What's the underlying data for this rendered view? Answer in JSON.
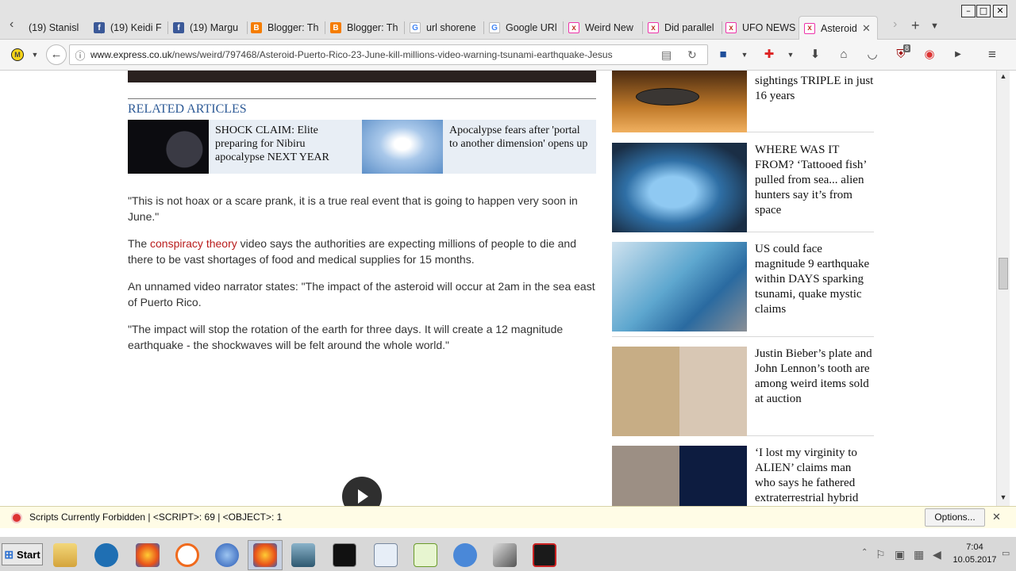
{
  "browser": {
    "tabs": [
      {
        "label": "(19) Stanisl",
        "icon": "facebook-icon"
      },
      {
        "label": "(19) Keidi F",
        "icon": "facebook-icon"
      },
      {
        "label": "(19) Margu",
        "icon": "facebook-icon"
      },
      {
        "label": "Blogger: Th",
        "icon": "blogger-icon"
      },
      {
        "label": "Blogger: Th",
        "icon": "blogger-icon"
      },
      {
        "label": "url shorene",
        "icon": "google-icon"
      },
      {
        "label": "Google URl",
        "icon": "google-icon"
      },
      {
        "label": "Weird New",
        "icon": "express-icon"
      },
      {
        "label": "Did parallel",
        "icon": "express-icon"
      },
      {
        "label": "UFO NEWS",
        "icon": "express-icon"
      },
      {
        "label": "Asteroid",
        "icon": "express-icon",
        "active": true
      }
    ],
    "url_host": "www.express.co.uk",
    "url_path": "/news/weird/797468/Asteroid-Puerto-Rico-23-June-kill-millions-video-warning-tsunami-earthquake-Jesus",
    "ublock_badge": "8"
  },
  "article": {
    "related_heading": "RELATED ARTICLES",
    "related": [
      {
        "title": "SHOCK CLAIM: Elite preparing for Nibiru apocalypse NEXT YEAR"
      },
      {
        "title": "Apocalypse fears after 'portal to another dimension' opens up"
      }
    ],
    "paragraphs": {
      "p1": "\"This is not hoax or a scare prank, it is a true real event that is going to happen very soon in June.\"",
      "p2_pre": "The ",
      "p2_link": "conspiracy theory",
      "p2_post": " video says the authorities are expecting millions of people to die and there to be vast shortages of food and medical supplies for 15 months.",
      "p3": "An unnamed video narrator states: \"The impact of the asteroid will occur at 2am in the sea east of Puerto Rico.",
      "p4": "\"The impact will stop the rotation of the earth for three days. It will create a 12 magnitude earthquake - the shockwaves will be felt around the whole world.\""
    }
  },
  "sidebar": [
    {
      "title": "sightings TRIPLE in just 16 years"
    },
    {
      "title": "WHERE WAS IT FROM? ‘Tattooed fish’ pulled from sea... alien hunters say it’s from space"
    },
    {
      "title": "US could face magnitude 9 earthquake within DAYS sparking tsunami, quake mystic claims"
    },
    {
      "title": "Justin Bieber’s plate and John Lennon’s tooth are among weird items sold at auction"
    },
    {
      "title": "‘I lost my virginity to ALIEN’ claims man who says he fathered extraterrestrial hybrid"
    }
  ],
  "noscript": {
    "message": "Scripts Currently Forbidden | <SCRIPT>: 69 | <OBJECT>: 1",
    "options_label": "Options..."
  },
  "taskbar": {
    "start_label": "Start",
    "time": "7:04",
    "date": "10.05.2017"
  }
}
